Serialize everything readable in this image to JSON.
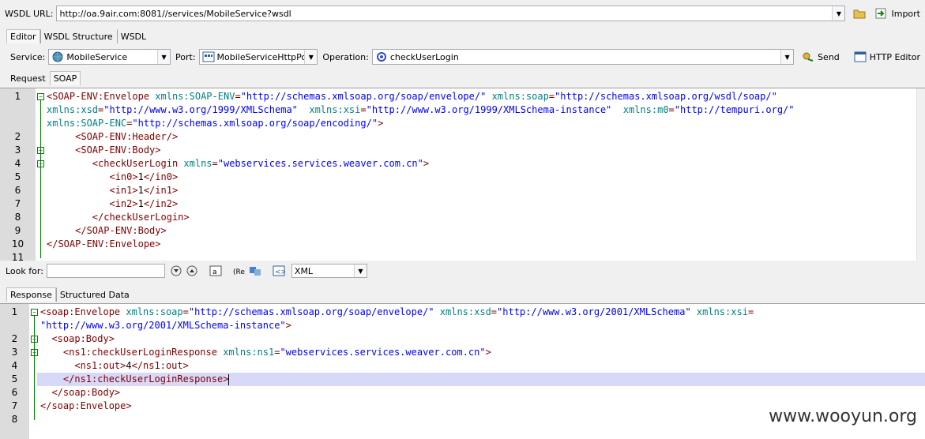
{
  "url_bar": {
    "label": "WSDL URL:",
    "value": "http://oa.9air.com:8081//services/MobileService?wsdl",
    "import_label": "Import"
  },
  "main_tabs": [
    "Editor",
    "WSDL Structure",
    "WSDL"
  ],
  "toolbar": {
    "service_label": "Service:",
    "service_value": "MobileService",
    "port_label": "Port:",
    "port_value": "MobileServiceHttpPort",
    "operation_label": "Operation:",
    "operation_value": "checkUserLogin",
    "send_label": "Send",
    "http_editor_label": "HTTP Editor"
  },
  "request_tabs": [
    "Request",
    "SOAP"
  ],
  "request_lines": [
    {
      "n": "1",
      "segs": [
        [
          "t",
          "<SOAP-ENV:Envelope "
        ],
        [
          "a",
          "xmlns:SOAP-ENV"
        ],
        [
          "t",
          "="
        ],
        [
          "v",
          "\"http://schemas.xmlsoap.org/soap/envelope/\""
        ],
        [
          "t",
          " "
        ],
        [
          "a",
          "xmlns:soap"
        ],
        [
          "t",
          "="
        ],
        [
          "v",
          "\"http://schemas.xmlsoap.org/wsdl/soap/\""
        ]
      ]
    },
    {
      "n": "",
      "segs": [
        [
          "a",
          "xmlns:xsd"
        ],
        [
          "t",
          "="
        ],
        [
          "v",
          "\"http://www.w3.org/1999/XMLSchema\""
        ],
        [
          "t",
          "  "
        ],
        [
          "a",
          "xmlns:xsi"
        ],
        [
          "t",
          "="
        ],
        [
          "v",
          "\"http://www.w3.org/1999/XMLSchema-instance\""
        ],
        [
          "t",
          "  "
        ],
        [
          "a",
          "xmlns:m0"
        ],
        [
          "t",
          "="
        ],
        [
          "v",
          "\"http://tempuri.org/\""
        ]
      ]
    },
    {
      "n": "",
      "segs": [
        [
          "a",
          "xmlns:SOAP-ENC"
        ],
        [
          "t",
          "="
        ],
        [
          "v",
          "\"http://schemas.xmlsoap.org/soap/encoding/\""
        ],
        [
          "t",
          ">"
        ]
      ]
    },
    {
      "n": "2",
      "segs": [
        [
          "t",
          "     <SOAP-ENV:Header/>"
        ]
      ]
    },
    {
      "n": "3",
      "segs": [
        [
          "t",
          "     <SOAP-ENV:Body>"
        ]
      ]
    },
    {
      "n": "4",
      "segs": [
        [
          "t",
          "        <checkUserLogin "
        ],
        [
          "a",
          "xmlns"
        ],
        [
          "t",
          "="
        ],
        [
          "v",
          "\"webservices.services.weaver.com.cn\""
        ],
        [
          "t",
          ">"
        ]
      ]
    },
    {
      "n": "5",
      "segs": [
        [
          "t",
          "           <in0>"
        ],
        [
          "k",
          "1"
        ],
        [
          "t",
          "</in0>"
        ]
      ]
    },
    {
      "n": "6",
      "segs": [
        [
          "t",
          "           <in1>"
        ],
        [
          "k",
          "1"
        ],
        [
          "t",
          "</in1>"
        ]
      ]
    },
    {
      "n": "7",
      "segs": [
        [
          "t",
          "           <in2>"
        ],
        [
          "k",
          "1"
        ],
        [
          "t",
          "</in2>"
        ]
      ]
    },
    {
      "n": "8",
      "segs": [
        [
          "t",
          "        </checkUserLogin>"
        ]
      ]
    },
    {
      "n": "9",
      "segs": [
        [
          "t",
          "     </SOAP-ENV:Body>"
        ]
      ]
    },
    {
      "n": "10",
      "segs": [
        [
          "t",
          "</SOAP-ENV:Envelope>"
        ]
      ]
    },
    {
      "n": "11",
      "segs": []
    }
  ],
  "search": {
    "label": "Look for:",
    "value": "",
    "format_value": "XML"
  },
  "response_tabs": [
    "Response",
    "Structured Data"
  ],
  "response_lines": [
    {
      "n": "1",
      "segs": [
        [
          "t",
          "<soap:Envelope "
        ],
        [
          "a",
          "xmlns:soap"
        ],
        [
          "t",
          "="
        ],
        [
          "v",
          "\"http://schemas.xmlsoap.org/soap/envelope/\""
        ],
        [
          "t",
          " "
        ],
        [
          "a",
          "xmlns:xsd"
        ],
        [
          "t",
          "="
        ],
        [
          "v",
          "\"http://www.w3.org/2001/XMLSchema\""
        ],
        [
          "t",
          " "
        ],
        [
          "a",
          "xmlns:xsi"
        ],
        [
          "t",
          "="
        ]
      ]
    },
    {
      "n": "",
      "segs": [
        [
          "v",
          "\"http://www.w3.org/2001/XMLSchema-instance\""
        ],
        [
          "t",
          ">"
        ]
      ]
    },
    {
      "n": "2",
      "segs": [
        [
          "t",
          "  <soap:Body>"
        ]
      ]
    },
    {
      "n": "3",
      "segs": [
        [
          "t",
          "    <ns1:checkUserLoginResponse "
        ],
        [
          "a",
          "xmlns:ns1"
        ],
        [
          "t",
          "="
        ],
        [
          "v",
          "\"webservices.services.weaver.com.cn\""
        ],
        [
          "t",
          ">"
        ]
      ]
    },
    {
      "n": "4",
      "segs": [
        [
          "t",
          "      <ns1:out>"
        ],
        [
          "k",
          "4"
        ],
        [
          "t",
          "</ns1:out>"
        ]
      ]
    },
    {
      "n": "5",
      "segs": [
        [
          "t",
          "    </ns1:checkUserLoginResponse>"
        ]
      ]
    },
    {
      "n": "6",
      "segs": [
        [
          "t",
          "  </soap:Body>"
        ]
      ]
    },
    {
      "n": "7",
      "segs": [
        [
          "t",
          "</soap:Envelope>"
        ]
      ]
    },
    {
      "n": "8",
      "segs": []
    }
  ],
  "watermark": "www.wooyun.org",
  "colors": {
    "tag": "#800000",
    "attr": "#008080",
    "value": "#0000ff",
    "highlight": "#d8d8f8"
  }
}
